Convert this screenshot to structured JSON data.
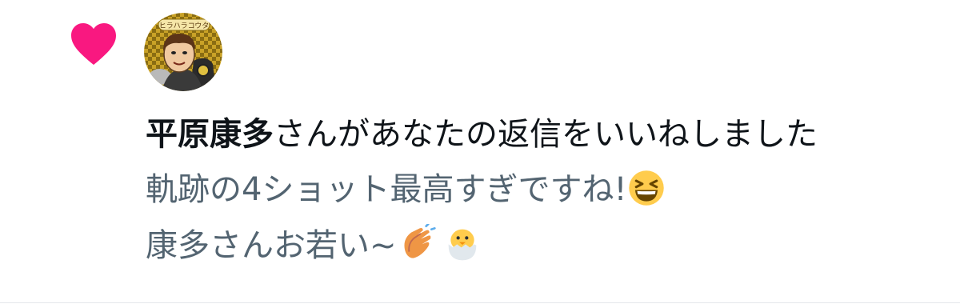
{
  "notification": {
    "type_icon": "heart-icon",
    "accent_color": "#f91880",
    "avatar": {
      "badge_text": "ヒラハラコウタ"
    },
    "headline": {
      "user_name": "平原康多",
      "action_text": "さんがあなたの返信をいいねしました"
    },
    "reply": {
      "line1_text": "軌跡の4ショット最高すぎですね!",
      "line1_emoji": "grinning-squinting-face-emoji",
      "line2_text": "康多さんお若い~",
      "line2_emojis": [
        "clapping-hands-emoji",
        "hatching-chick-emoji"
      ]
    }
  }
}
